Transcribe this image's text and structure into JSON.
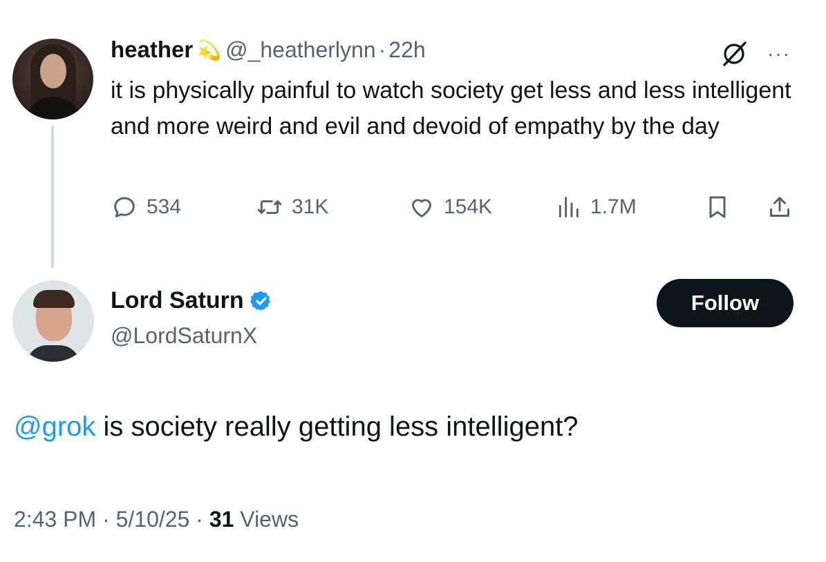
{
  "original_tweet": {
    "display_name": "heather",
    "badge_emoji": "💫",
    "handle": "@_heatherlynn",
    "separator": "·",
    "time": "22h",
    "text": "it is physically painful to watch society get less and less intelligent and more weird and evil and devoid of empathy by the day",
    "more_label": "···",
    "stats": {
      "replies": "534",
      "retweets": "31K",
      "likes": "154K",
      "views": "1.7M"
    }
  },
  "reply_tweet": {
    "display_name": "Lord Saturn",
    "handle": "@LordSaturnX",
    "follow_label": "Follow",
    "mention": "@grok",
    "text": " is society really getting less intelligent?",
    "meta": {
      "time": "2:43 PM",
      "sep1": " · ",
      "date": "5/10/25",
      "sep2": " · ",
      "views_count": "31",
      "views_label": " Views"
    }
  },
  "colors": {
    "text_primary": "#0f1419",
    "text_secondary": "#536471",
    "accent_blue": "#1d9bf0",
    "button_dark": "#0f1419",
    "thread_line": "#cfd9de"
  },
  "icons": [
    "reply-icon",
    "retweet-icon",
    "like-icon",
    "views-icon",
    "bookmark-icon",
    "share-icon",
    "grok-icon",
    "more-icon",
    "verified-icon"
  ]
}
